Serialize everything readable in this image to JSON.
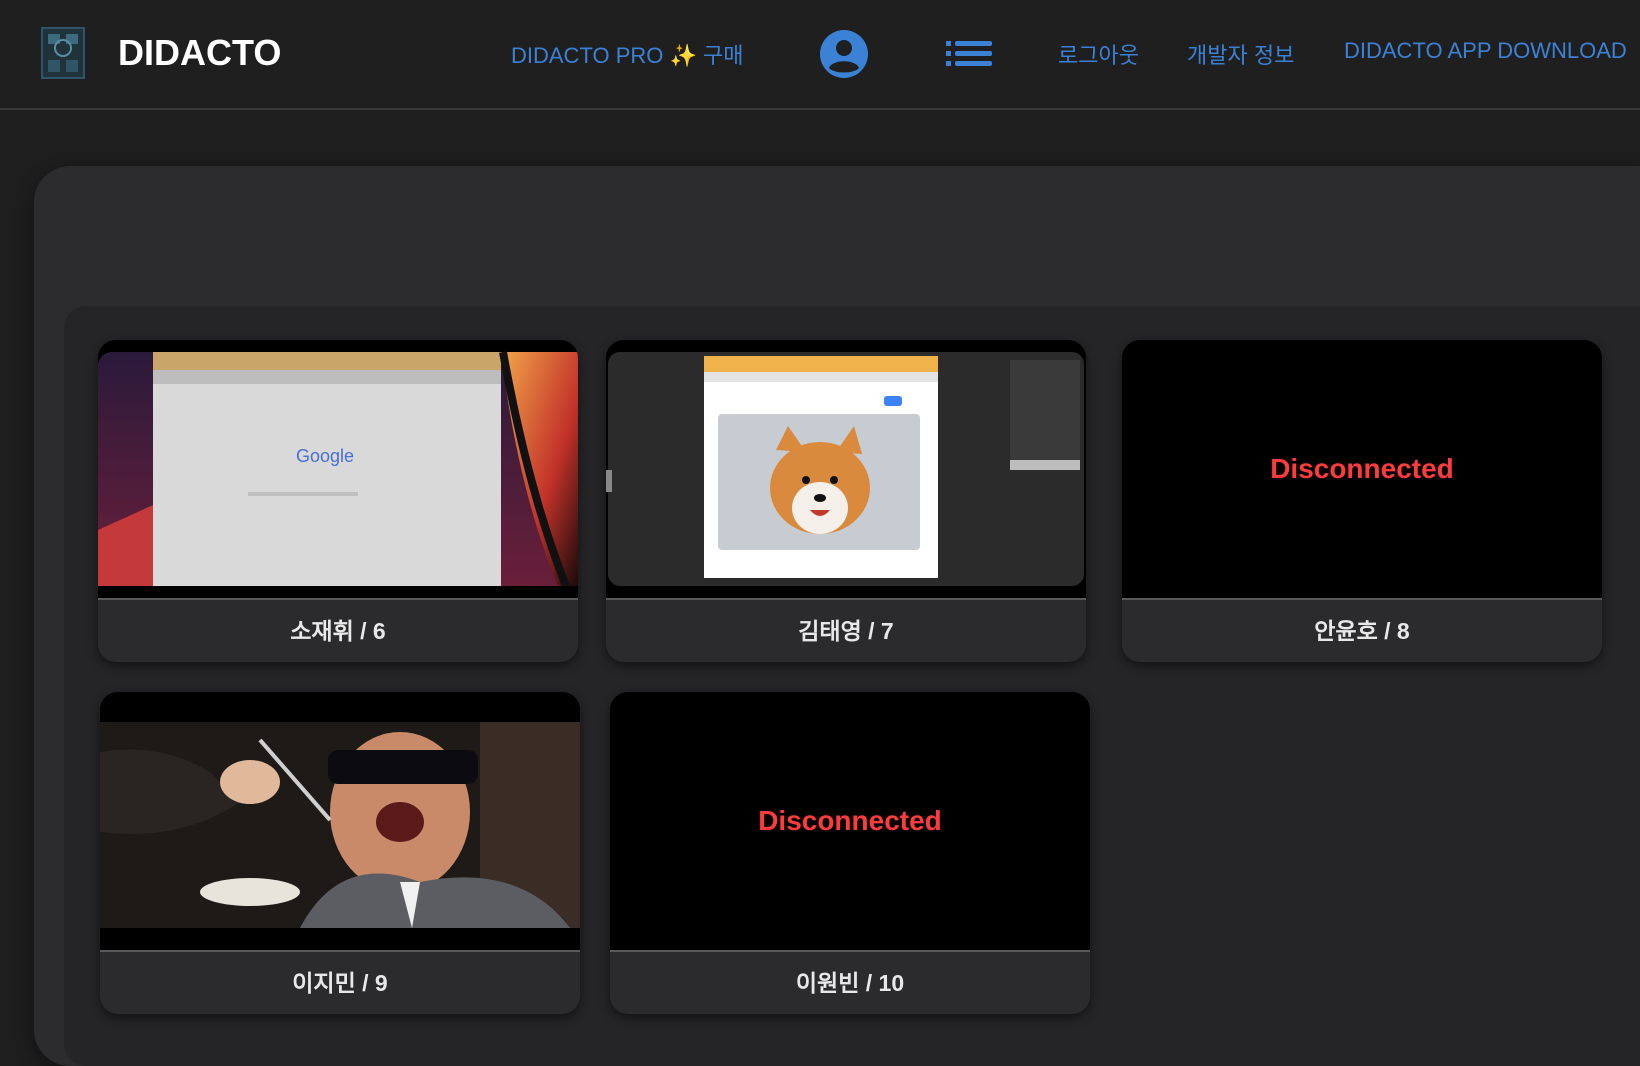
{
  "header": {
    "brand": "DIDACTO",
    "pro_link": "DIDACTO PRO ✨ 구매",
    "logout_link": "로그아웃",
    "dev_info_link": "개발자 정보",
    "app_download_link": "DIDACTO APP DOWNLOAD",
    "logo_icon": "building-logo-icon",
    "profile_icon": "user-avatar-icon",
    "menu_icon": "list-menu-icon"
  },
  "colors": {
    "accent": "#3b82d6",
    "disconnected": "#ff3b3b",
    "background": "#1e1e1f"
  },
  "cards": [
    {
      "label": "소재휘 / 6",
      "status": "connected",
      "thumbnail": "browser-google-screen"
    },
    {
      "label": "김태영 / 7",
      "status": "connected",
      "thumbnail": "browser-dog-image-screen"
    },
    {
      "label": "안윤호 / 8",
      "status": "disconnected",
      "status_text": "Disconnected"
    },
    {
      "label": "이지민 / 9",
      "status": "connected",
      "thumbnail": "webcam-video-frame"
    },
    {
      "label": "이원빈 / 10",
      "status": "disconnected",
      "status_text": "Disconnected"
    }
  ]
}
